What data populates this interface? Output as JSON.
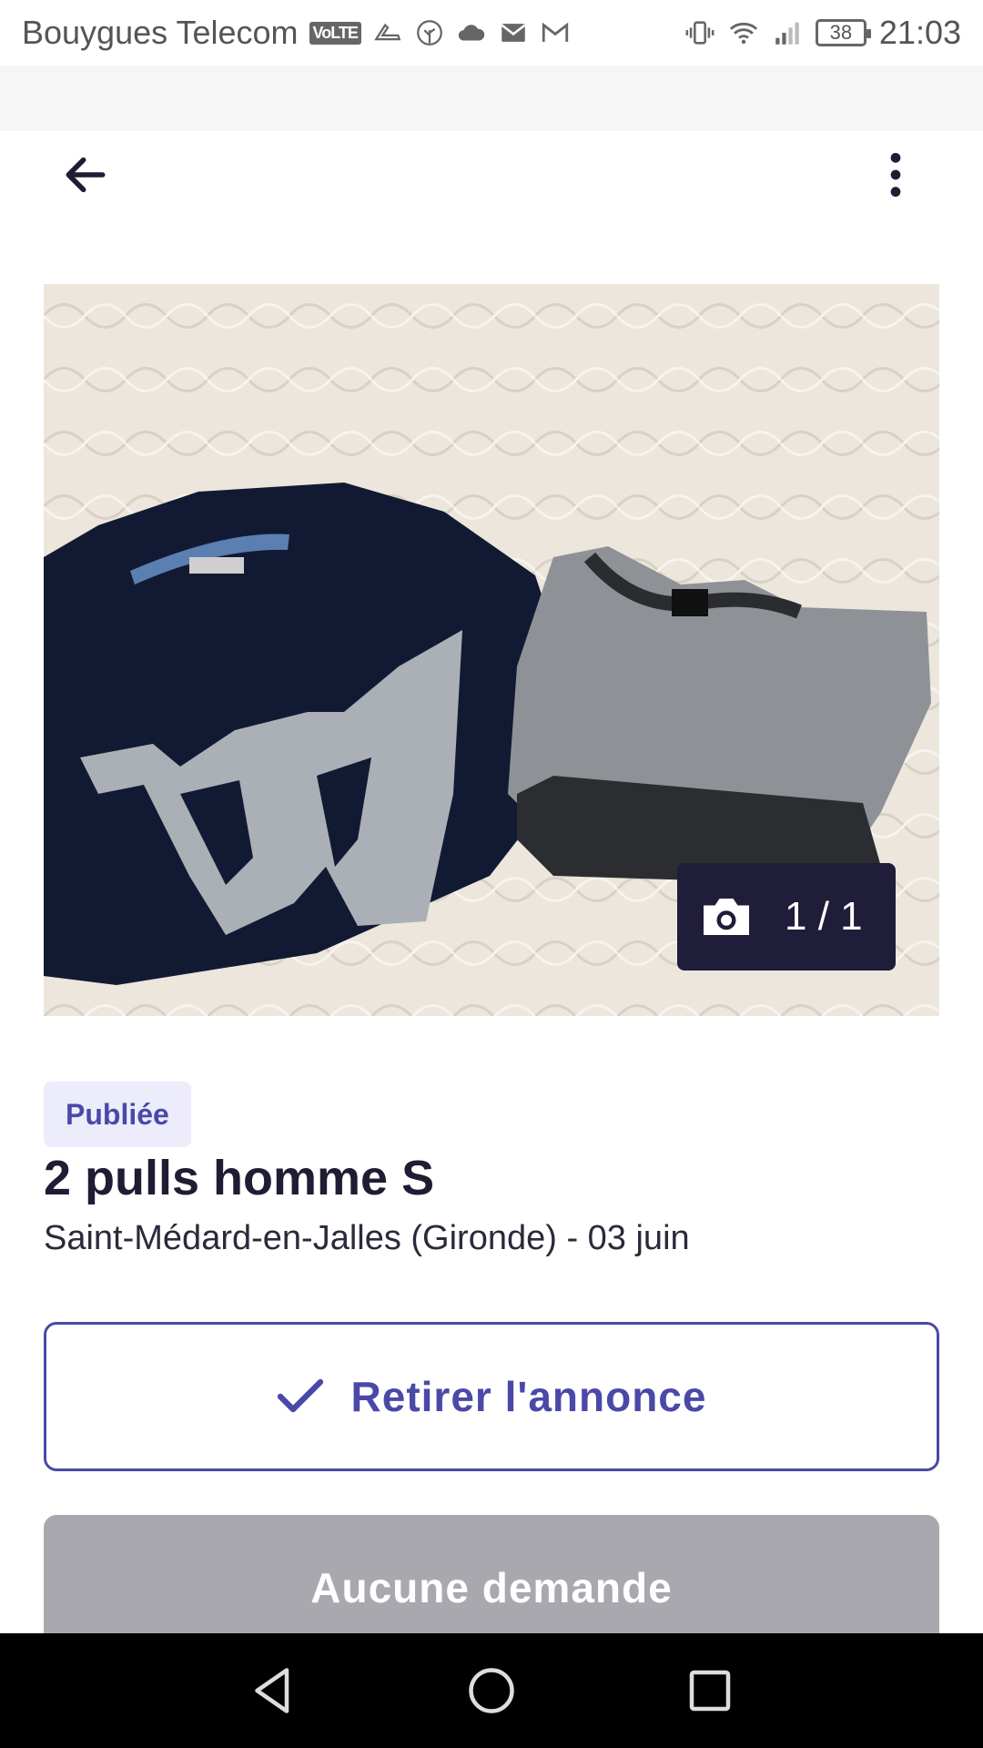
{
  "status_bar": {
    "carrier": "Bouygues Telecom",
    "volte": "VoLTE",
    "battery": "38",
    "time": "21:03"
  },
  "header": {
    "back_icon": "arrow-left-icon",
    "menu_icon": "more-vertical-icon"
  },
  "photo": {
    "counter": "1 / 1",
    "camera_icon": "camera-icon"
  },
  "listing": {
    "status_badge": "Publiée",
    "title": "2 pulls homme S",
    "location_date": "Saint-Médard-en-Jalles (Gironde) - 03 juin"
  },
  "actions": {
    "withdraw_label": "Retirer l'annonce",
    "requests_label": "Aucune demande"
  },
  "colors": {
    "accent": "#4a49a8",
    "badge_bg": "#ececfb",
    "counter_bg": "#1f1d3a",
    "disabled": "#a8a8ae"
  }
}
